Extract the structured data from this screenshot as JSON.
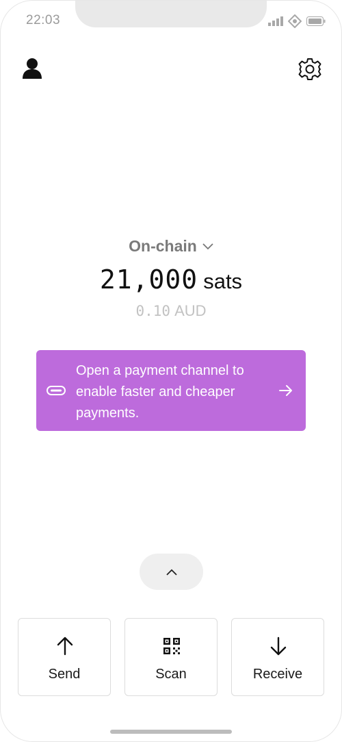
{
  "status_bar": {
    "time": "22:03",
    "icons": [
      "signal-icon",
      "wifi-icon",
      "battery-icon"
    ]
  },
  "header": {
    "profile_icon": "person-icon",
    "settings_icon": "gear-icon"
  },
  "wallet": {
    "network": "On-chain",
    "balance_amount": "21,000",
    "balance_unit": "sats",
    "fiat_amount": "0.10",
    "fiat_currency": "AUD"
  },
  "banner": {
    "text": "Open a payment channel to enable faster and cheaper payments.",
    "color": "#bd6bdc",
    "icon": "channel-icon",
    "action_icon": "arrow-right-icon"
  },
  "actions": {
    "expand_icon": "chevron-up-icon",
    "send_label": "Send",
    "scan_label": "Scan",
    "receive_label": "Receive"
  }
}
